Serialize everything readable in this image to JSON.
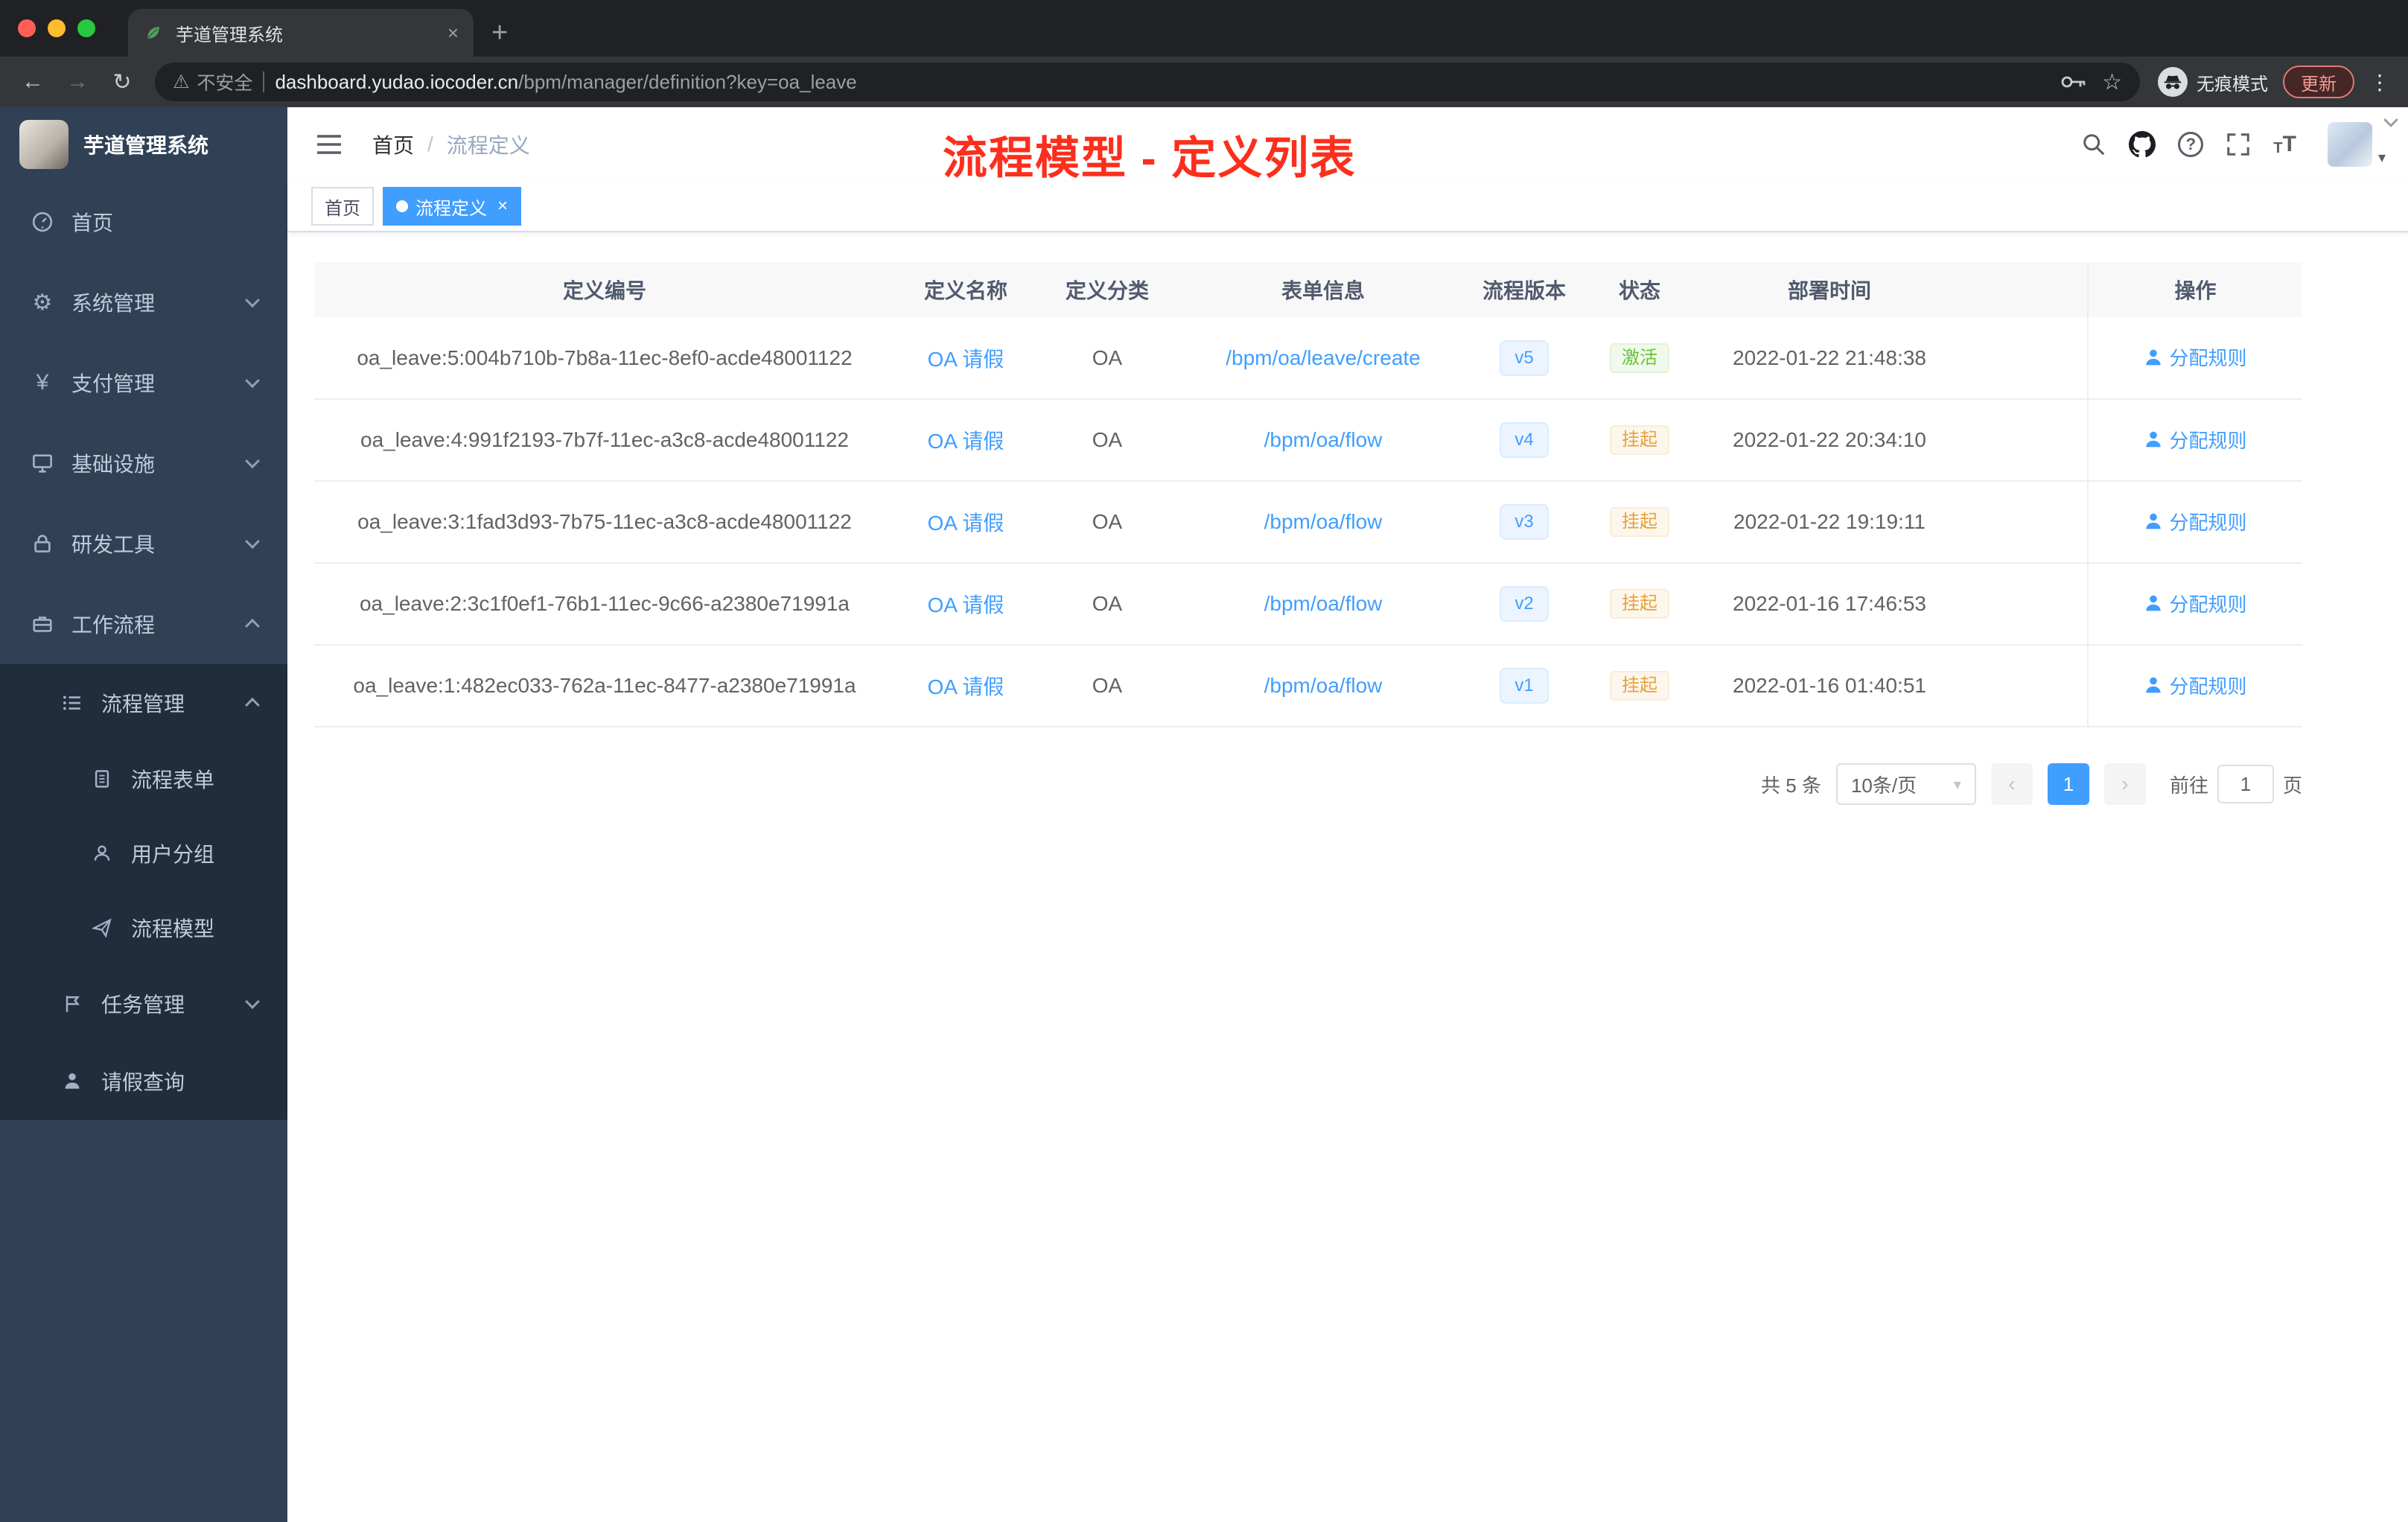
{
  "browser": {
    "tab_title": "芋道管理系统",
    "security": "不安全",
    "host": "dashboard.yudao.iocoder.cn",
    "path": "/bpm/manager/definition?key=oa_leave",
    "incognito": "无痕模式",
    "update": "更新"
  },
  "sidebar": {
    "title": "芋道管理系统",
    "items": [
      "首页",
      "系统管理",
      "支付管理",
      "基础设施",
      "研发工具",
      "工作流程"
    ],
    "sub": [
      "流程管理",
      "流程表单",
      "用户分组",
      "流程模型",
      "任务管理",
      "请假查询"
    ]
  },
  "breadcrumb": {
    "home": "首页",
    "sep": "/",
    "current": "流程定义"
  },
  "annotation": "流程模型 - 定义列表",
  "tags": {
    "home": "首页",
    "current": "流程定义"
  },
  "table": {
    "headers": [
      "定义编号",
      "定义名称",
      "定义分类",
      "表单信息",
      "流程版本",
      "状态",
      "部署时间",
      "操作"
    ],
    "rows": [
      {
        "id": "oa_leave:5:004b710b-7b8a-11ec-8ef0-acde48001122",
        "name": "OA 请假",
        "category": "OA",
        "form": "/bpm/oa/leave/create",
        "version": "v5",
        "status": "激活",
        "time": "2022-01-22 21:48:38",
        "action": "分配规则"
      },
      {
        "id": "oa_leave:4:991f2193-7b7f-11ec-a3c8-acde48001122",
        "name": "OA 请假",
        "category": "OA",
        "form": "/bpm/oa/flow",
        "version": "v4",
        "status": "挂起",
        "time": "2022-01-22 20:34:10",
        "action": "分配规则"
      },
      {
        "id": "oa_leave:3:1fad3d93-7b75-11ec-a3c8-acde48001122",
        "name": "OA 请假",
        "category": "OA",
        "form": "/bpm/oa/flow",
        "version": "v3",
        "status": "挂起",
        "time": "2022-01-22 19:19:11",
        "action": "分配规则"
      },
      {
        "id": "oa_leave:2:3c1f0ef1-76b1-11ec-9c66-a2380e71991a",
        "name": "OA 请假",
        "category": "OA",
        "form": "/bpm/oa/flow",
        "version": "v2",
        "status": "挂起",
        "time": "2022-01-16 17:46:53",
        "action": "分配规则"
      },
      {
        "id": "oa_leave:1:482ec033-762a-11ec-8477-a2380e71991a",
        "name": "OA 请假",
        "category": "OA",
        "form": "/bpm/oa/flow",
        "version": "v1",
        "status": "挂起",
        "time": "2022-01-16 01:40:51",
        "action": "分配规则"
      }
    ]
  },
  "pagination": {
    "total": "共 5 条",
    "page_size": "10条/页",
    "page": "1",
    "goto_label": "前往",
    "goto_value": "1",
    "page_unit": "页"
  },
  "icons": {
    "close": "×",
    "plus": "+",
    "back": "←",
    "forward": "→",
    "reload": "↻",
    "warning": "⚠",
    "star": "☆",
    "more": "⋮",
    "caret": "▾",
    "prev": "‹",
    "next": "›",
    "question": "?",
    "gear": "⚙",
    "yen": "¥",
    "font_small": "T",
    "font_big": "T"
  }
}
